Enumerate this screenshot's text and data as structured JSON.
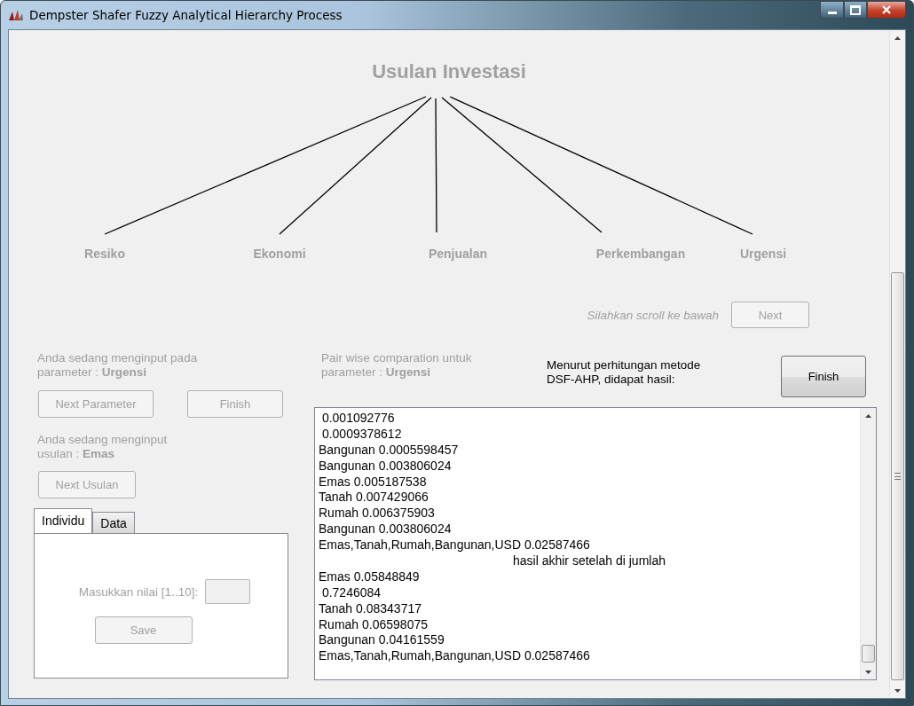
{
  "window": {
    "title": "Dempster Shafer Fuzzy Analytical Hierarchy Process"
  },
  "diagram": {
    "root": "Usulan Investasi",
    "children": [
      {
        "label": "Resiko"
      },
      {
        "label": "Ekonomi"
      },
      {
        "label": "Penjualan"
      },
      {
        "label": "Perkembangan"
      },
      {
        "label": "Urgensi"
      }
    ]
  },
  "scroll_hint": {
    "text": "Silahkan scroll ke bawah",
    "disabled": true
  },
  "next_button": {
    "label": "Next",
    "disabled": true
  },
  "input_panel": {
    "parameter_label": {
      "text": "Anda sedang menginput pada\nparameter : **Urgensi**",
      "disabled": true
    },
    "buttons": [
      {
        "label": "Next Parameter",
        "disabled": true
      },
      {
        "label": "Finish",
        "disabled": true
      }
    ],
    "usulan_label": {
      "text": "Anda sedang menginput\nusulan :  **Emas**",
      "disabled": true
    },
    "next_usulan_button": {
      "label": "Next Usulan",
      "disabled": true
    },
    "tabs": [
      {
        "label": "Individu",
        "selected": true
      },
      {
        "label": "Data",
        "selected": false
      }
    ],
    "value_label": {
      "text": "Masukkan nilai [1..10]:",
      "disabled": true
    },
    "value_field": {
      "disabled": true
    },
    "save_button": {
      "label": "Save",
      "disabled": true
    }
  },
  "comparison_label": {
    "text": "Pair wise comparation untuk\nparameter :   **Urgensi**",
    "disabled": true
  },
  "result_label": {
    "text": "Menurut perhitungan metode\nDSF-AHP, didapat hasil:",
    "disabled": false
  },
  "finish_button": {
    "label": "Finish",
    "disabled": false
  },
  "result_log": [
    {
      "kind": "line",
      "text": " 0.001092776"
    },
    {
      "kind": "line",
      "text": " 0.0009378612"
    },
    {
      "kind": "line",
      "text": "Bangunan 0.0005598457"
    },
    {
      "kind": "line",
      "text": "Bangunan 0.003806024"
    },
    {
      "kind": "line",
      "text": "Emas 0.005187538"
    },
    {
      "kind": "line",
      "text": "Tanah 0.007429066"
    },
    {
      "kind": "line",
      "text": "Rumah 0.006375903"
    },
    {
      "kind": "line",
      "text": "Bangunan 0.003806024"
    },
    {
      "kind": "line",
      "text": "Emas,Tanah,Rumah,Bangunan,USD 0.02587466"
    },
    {
      "kind": "center",
      "text": "hasil akhir setelah di jumlah"
    },
    {
      "kind": "line",
      "text": "Emas 0.05848849"
    },
    {
      "kind": "line",
      "text": " 0.7246084"
    },
    {
      "kind": "line",
      "text": "Tanah 0.08343717"
    },
    {
      "kind": "line",
      "text": "Rumah 0.06598075"
    },
    {
      "kind": "line",
      "text": "Bangunan 0.04161559"
    },
    {
      "kind": "line",
      "text": "Emas,Tanah,Rumah,Bangunan,USD 0.02587466"
    }
  ]
}
